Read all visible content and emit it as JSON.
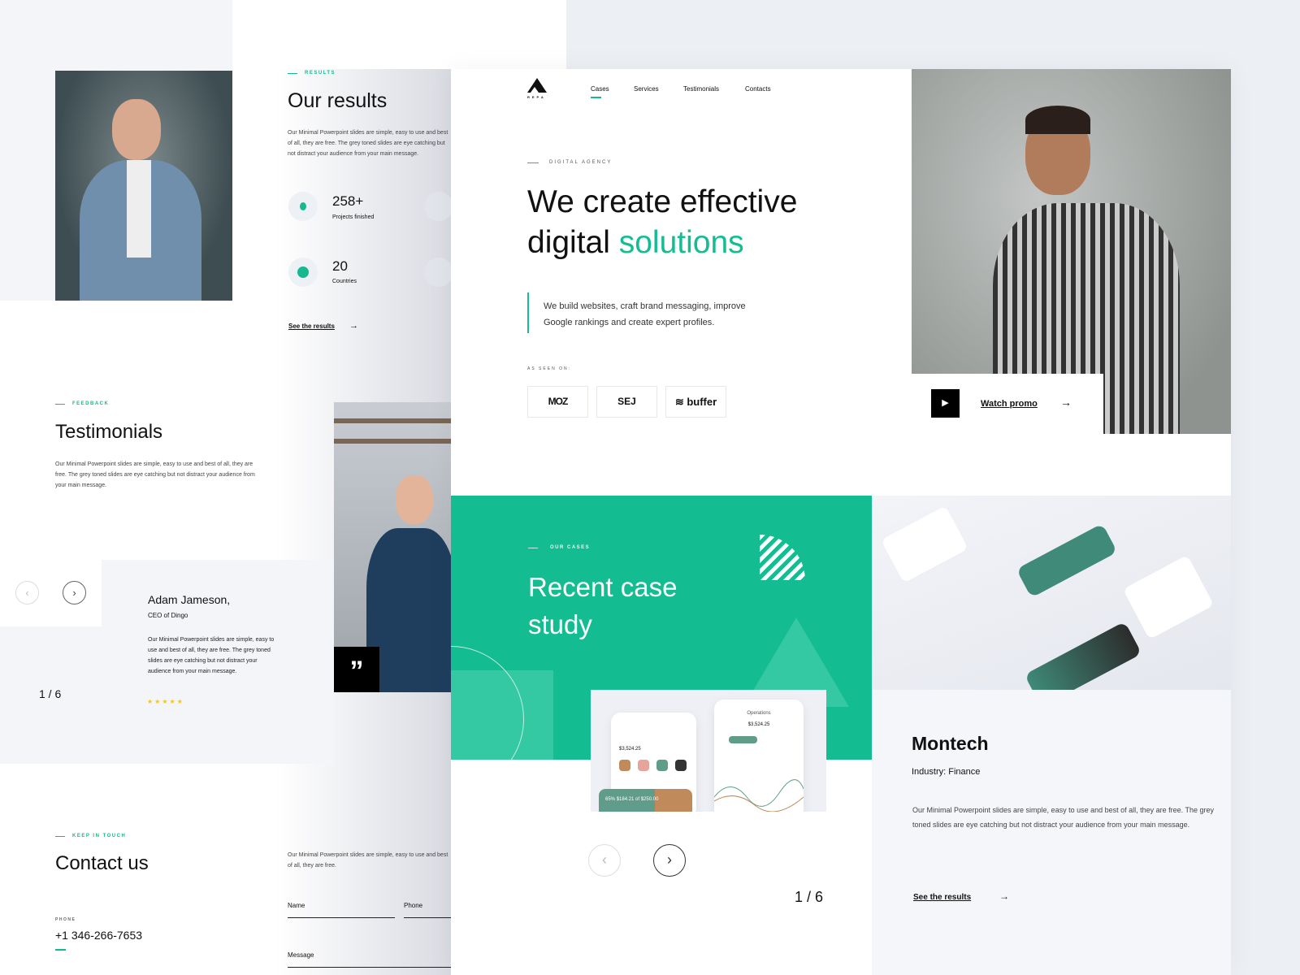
{
  "colors": {
    "accent": "#13bd91",
    "star": "#f5c518"
  },
  "results": {
    "label": "Results",
    "title": "Our results",
    "text": "Our Minimal Powerpoint slides are simple,  easy to use and best of all, they are free. The  grey toned slides are eye catching but not  distract your audience from your main  message.",
    "stats": [
      {
        "value": "258+",
        "label": "Projects finished",
        "icon": "lightbulb-icon"
      },
      {
        "value": "20",
        "label": "Countries",
        "icon": "globe-icon"
      }
    ],
    "link": "See the results"
  },
  "testimonials": {
    "label": "Feedback",
    "title": "Testimonials",
    "text": "Our Minimal Powerpoint slides are simple,  easy to use and best of all, they are free. The  grey toned slides are eye catching but not  distract your audience from your main  message.",
    "name": "Adam Jameson,",
    "role": "CEO of Dingo",
    "quote": "Our Minimal Powerpoint slides are simple,  easy to use and best of all, they are free. The  grey toned slides are eye catching but not  distract your audience from your main  message.",
    "rating": 5,
    "pager": "1 / 6"
  },
  "contact": {
    "label": "Keep in touch",
    "title": "Contact us",
    "phone_label": "Phone",
    "phone": "+1 346-266-7653",
    "text": "Our Minimal Powerpoint slides are simple,  easy to use and best of all, they are free.",
    "fields": {
      "name": "Name",
      "phone": "Phone",
      "message": "Message"
    }
  },
  "nav": {
    "logo": "REPA",
    "items": [
      "Cases",
      "Services",
      "Testimonials",
      "Contacts"
    ],
    "active": 0
  },
  "hero": {
    "label": "Digital agency",
    "title_line1": "We create effective",
    "title_line2a": "digital ",
    "title_line2b": "solutions",
    "text_line1": "We build websites, craft brand messaging, improve",
    "text_line2": "Google rankings and create expert profiles.",
    "seen_on": "As seen on:",
    "logos": [
      "MOZ",
      "SEJ",
      "buffer"
    ],
    "watch": "Watch promo"
  },
  "cases": {
    "label": "Our cases",
    "title_line1": "Recent case",
    "title_line2": "study",
    "pager": "1 / 6",
    "mockup": {
      "balance": "$3,524.25",
      "screen": "Operations",
      "percent": "65%",
      "daily": "$184.21 of $250.00"
    }
  },
  "case": {
    "title": "Montech",
    "industry": "Industry: Finance",
    "text": "Our Minimal Powerpoint slides are simple,  easy to use and best of all, they are free. The  grey toned slides are eye catching but not  distract your audience from your main  message.",
    "link": "See the results"
  }
}
